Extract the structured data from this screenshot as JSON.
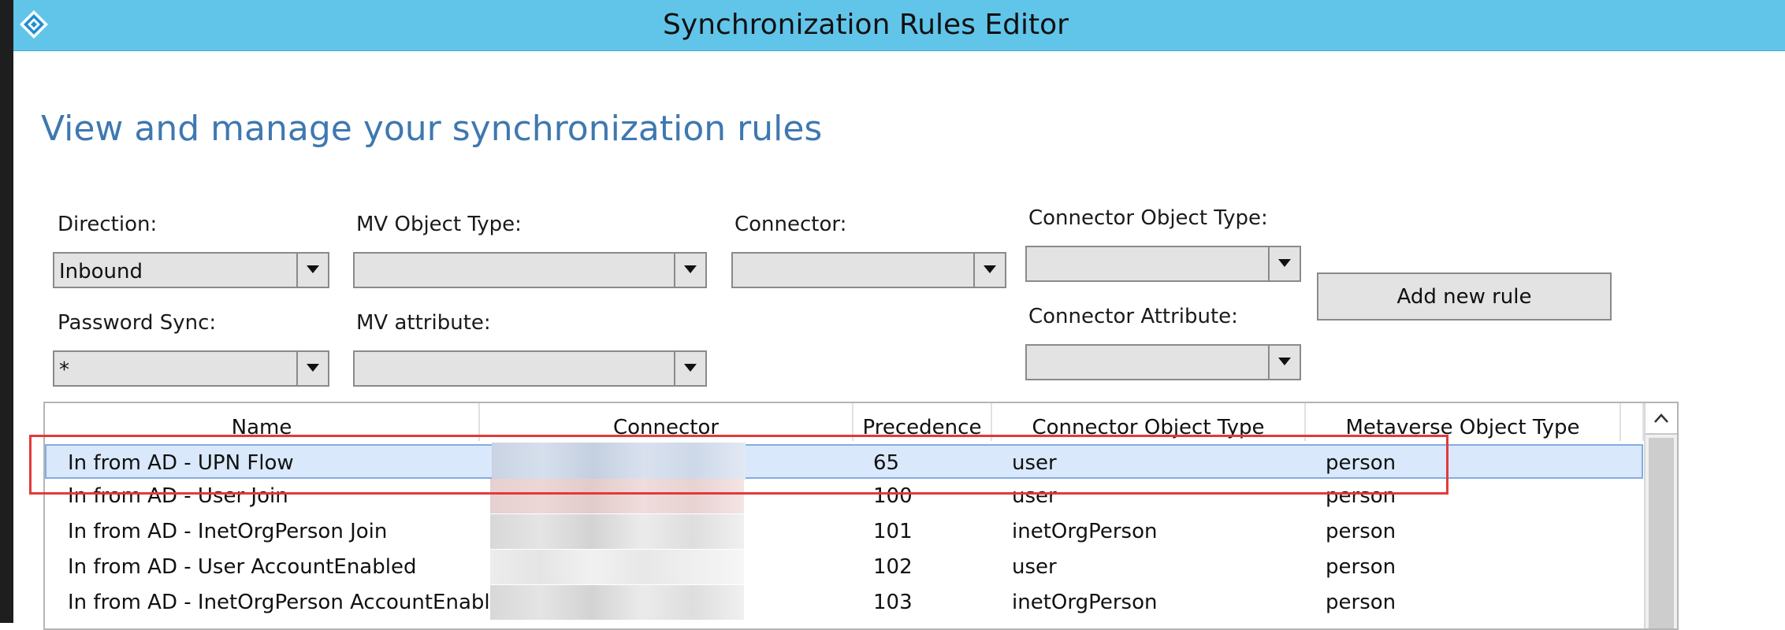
{
  "window": {
    "title": "Synchronization Rules Editor",
    "icon": "azure-ad-connect-icon"
  },
  "page": {
    "heading": "View and manage your synchronization rules"
  },
  "filters": {
    "direction": {
      "label": "Direction:",
      "value": "Inbound"
    },
    "mv_object_type": {
      "label": "MV Object Type:",
      "value": ""
    },
    "connector": {
      "label": "Connector:",
      "value": ""
    },
    "connector_object_type": {
      "label": "Connector Object Type:",
      "value": ""
    },
    "password_sync": {
      "label": "Password Sync:",
      "value": "*"
    },
    "mv_attribute": {
      "label": "MV attribute:",
      "value": ""
    },
    "connector_attribute": {
      "label": "Connector Attribute:",
      "value": ""
    }
  },
  "actions": {
    "add_new_rule": "Add new rule"
  },
  "grid": {
    "columns": [
      "Name",
      "Connector",
      "Precedence",
      "Connector Object Type",
      "Metaverse Object Type"
    ],
    "rows": [
      {
        "name": "In from AD - UPN Flow",
        "connector": "",
        "precedence": "65",
        "connector_object_type": "user",
        "metaverse_object_type": "person",
        "selected": true
      },
      {
        "name": "In from AD - User Join",
        "connector": "",
        "precedence": "100",
        "connector_object_type": "user",
        "metaverse_object_type": "person",
        "selected": false
      },
      {
        "name": "In from AD - InetOrgPerson Join",
        "connector": "",
        "precedence": "101",
        "connector_object_type": "inetOrgPerson",
        "metaverse_object_type": "person",
        "selected": false
      },
      {
        "name": "In from AD - User AccountEnabled",
        "connector": "",
        "precedence": "102",
        "connector_object_type": "user",
        "metaverse_object_type": "person",
        "selected": false
      },
      {
        "name": "In from AD - InetOrgPerson AccountEnabled",
        "connector": "",
        "precedence": "103",
        "connector_object_type": "inetOrgPerson",
        "metaverse_object_type": "person",
        "selected": false
      }
    ]
  },
  "colors": {
    "titlebar": "#61c5ea",
    "heading": "#3f78b0",
    "selection": "#d9e8fb",
    "annotation": "#e23a3a"
  }
}
